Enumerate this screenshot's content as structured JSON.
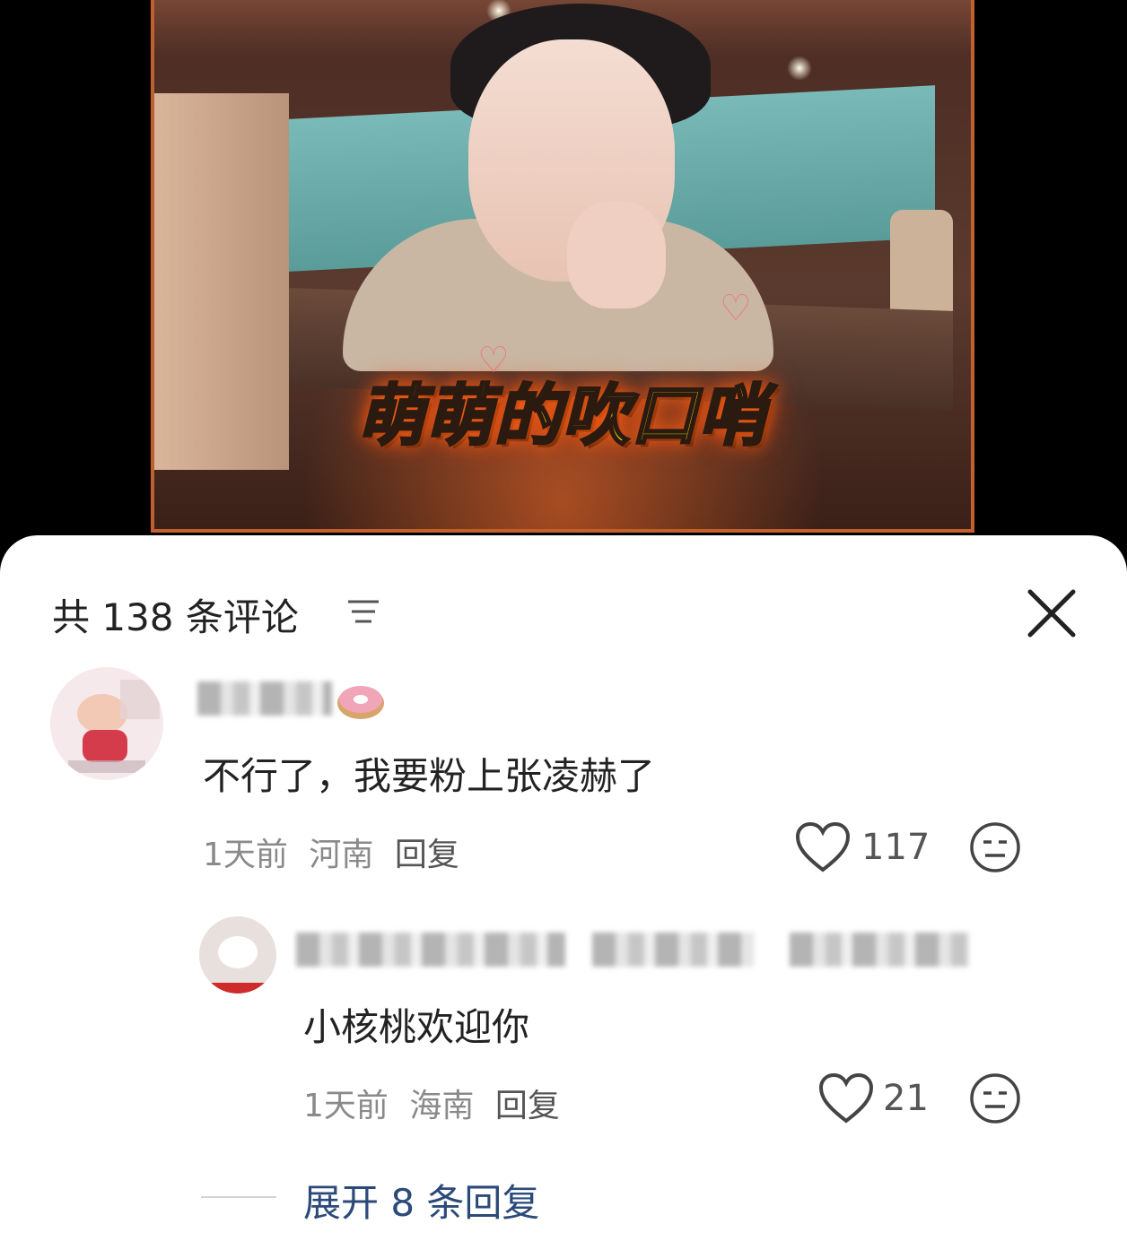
{
  "video": {
    "caption": "萌萌的吹口哨"
  },
  "comments_panel": {
    "header": "共 138 条评论",
    "sort_icon": "sort-lines-icon",
    "close_icon": "close-x-icon"
  },
  "comments": [
    {
      "text": "不行了，我要粉上张凌赫了",
      "time": "1天前",
      "location": "河南",
      "reply_label": "回复",
      "likes": "117"
    }
  ],
  "replies": [
    {
      "text": "小核桃欢迎你",
      "time": "1天前",
      "location": "海南",
      "reply_label": "回复",
      "likes": "21"
    }
  ],
  "expand_label": "展开 8 条回复"
}
